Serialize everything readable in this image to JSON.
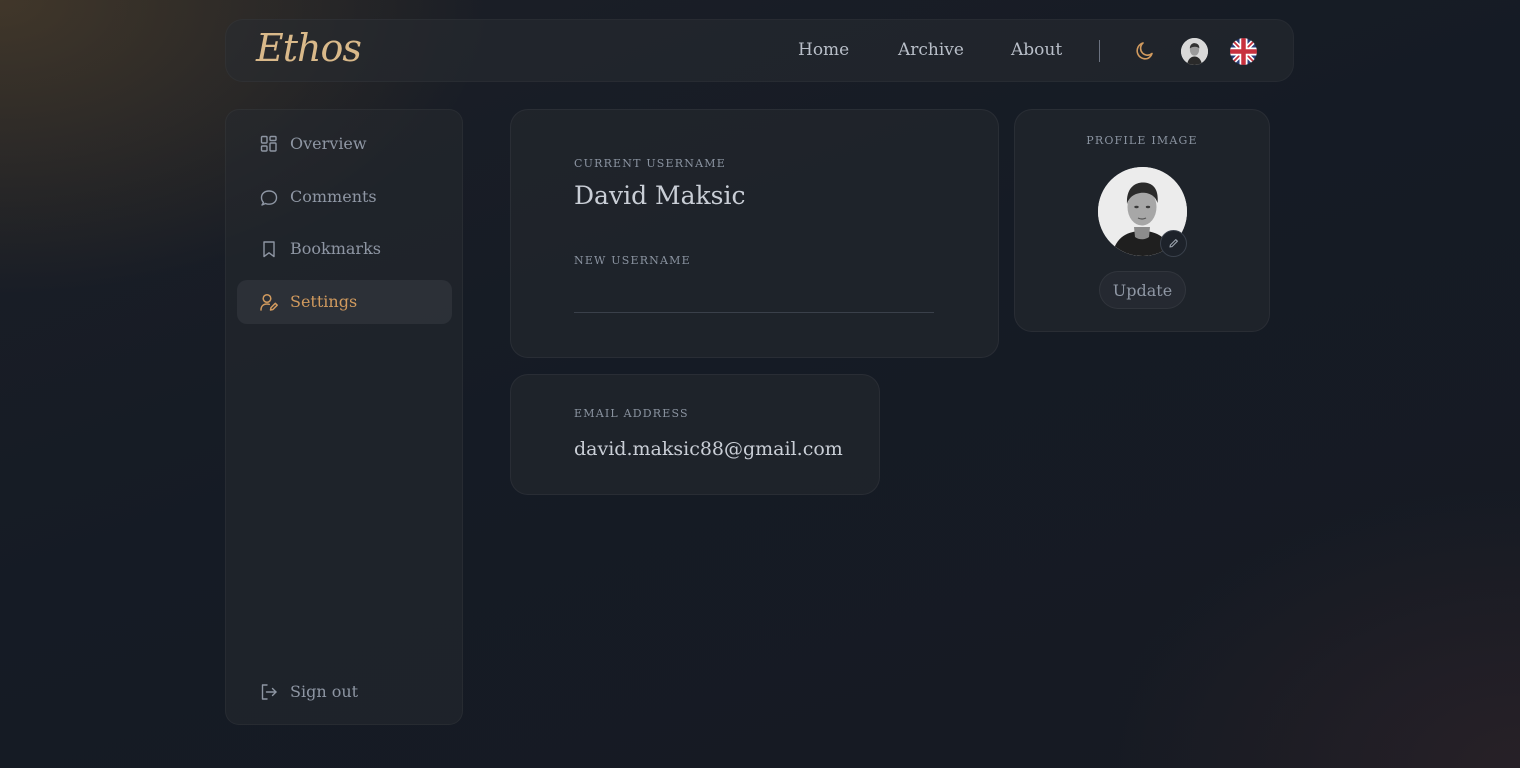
{
  "header": {
    "logo": "Ethos",
    "nav": [
      {
        "label": "Home"
      },
      {
        "label": "Archive"
      },
      {
        "label": "About"
      }
    ],
    "icons": [
      "moon-icon",
      "avatar",
      "uk-flag-icon"
    ]
  },
  "sidebar": {
    "items": [
      {
        "label": "Overview",
        "icon": "grid-icon"
      },
      {
        "label": "Comments",
        "icon": "comment-icon"
      },
      {
        "label": "Bookmarks",
        "icon": "bookmark-icon"
      },
      {
        "label": "Settings",
        "icon": "user-edit-icon",
        "active": true
      }
    ],
    "signout": {
      "label": "Sign out",
      "icon": "signout-icon"
    }
  },
  "username_card": {
    "current_label": "Current Username",
    "current_value": "David Maksic",
    "new_label": "New Username",
    "new_value": "",
    "new_placeholder": ""
  },
  "email_card": {
    "label": "Email Address",
    "value": "david.maksic88@gmail.com"
  },
  "profile_card": {
    "label": "Profile Image",
    "update_label": "Update"
  },
  "colors": {
    "accent": "#d19a5e",
    "logo": "#d9b98a"
  }
}
